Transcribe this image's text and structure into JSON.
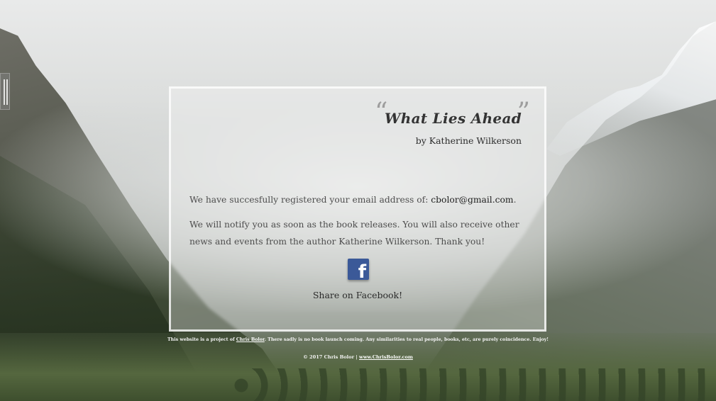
{
  "book": {
    "title": "What Lies Ahead",
    "byline": "by Katherine Wilkerson",
    "open_quote": "“",
    "close_quote": "”"
  },
  "message": {
    "line1_prefix": "We have succesfully registered your email address of: ",
    "email": "cbolor@gmail.com",
    "line1_suffix": ".",
    "line2": "We will notify you as soon as the book releases. You will also receive other news and events from the author Katherine Wilkerson. Thank you!"
  },
  "share": {
    "icon": "facebook-icon",
    "icon_glyph": "f",
    "label": "Share on Facebook!",
    "color": "#3b5998"
  },
  "footer": {
    "note_prefix": "This website is a project of ",
    "author_link": "Chris Bolor",
    "note_suffix": ". There sadly is no book launch coming. Any similarities to real people, books, etc, are purely coincidence. Enjoy!",
    "copyright": "© 2017 Chris Bolor | ",
    "site_link": "www.ChrisBolor.com"
  }
}
